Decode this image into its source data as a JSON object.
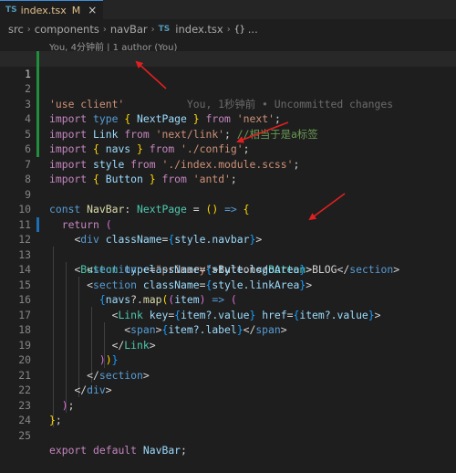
{
  "tab": {
    "lang": "TS",
    "filename": "index.tsx",
    "modified": "M",
    "close": "×"
  },
  "breadcrumb": {
    "items": [
      "src",
      "components",
      "navBar",
      "index.tsx",
      "..."
    ],
    "ts_badge": "TS",
    "braces": "{}"
  },
  "blame_header": "You, 4分钟前 | 1 author (You)",
  "inline_blame": "You, 1秒钟前 • Uncommitted changes",
  "line_numbers": [
    "1",
    "2",
    "3",
    "4",
    "5",
    "6",
    "7",
    "8",
    "9",
    "10",
    "11",
    "12",
    "13",
    "14",
    "15",
    "16",
    "17",
    "18",
    "19",
    "20",
    "21",
    "22",
    "23",
    "24",
    "25"
  ],
  "code": {
    "l1": "'use client'",
    "l2": {
      "import": "import",
      "type": "type",
      "name": "NextPage",
      "from": "from",
      "src": "'next'"
    },
    "l3": {
      "import": "import",
      "name": "Link",
      "from": "from",
      "src": "'next/link'",
      "comment": "//相当于是a标签"
    },
    "l4": {
      "import": "import",
      "name": "navs",
      "from": "from",
      "src": "'./config'"
    },
    "l5": {
      "import": "import",
      "name": "style",
      "from": "from",
      "src": "'./index.module.scss'"
    },
    "l6": {
      "import": "import",
      "name": "Button",
      "from": "from",
      "src": "'antd'"
    },
    "l9": {
      "const": "const",
      "name": "NavBar",
      "type": "NextPage"
    },
    "l10": "return",
    "l11": {
      "tag": "div",
      "attr": "className",
      "val": "style.navbar"
    },
    "l12": {
      "tag": "Button",
      "attr": "type",
      "val": "\"primary\"",
      "text": "Button"
    },
    "l13": {
      "tag": "section",
      "attr": "className",
      "val": "style.logoArea",
      "text": "BLOG"
    },
    "l14": {
      "tag": "section",
      "attr": "className",
      "val": "style.linkArea"
    },
    "l15": {
      "obj": "navs",
      "method": "map",
      "param": "item"
    },
    "l16": {
      "tag": "Link",
      "attr1": "key",
      "val1": "item?.value",
      "attr2": "href",
      "val2": "item?.value"
    },
    "l17": {
      "tag": "span",
      "val": "item?.label"
    },
    "l18": {
      "tag": "Link"
    },
    "l20": {
      "tag": "section"
    },
    "l21": {
      "tag": "div"
    },
    "l25": {
      "export": "export",
      "default": "default",
      "name": "NavBar"
    }
  },
  "colors": {
    "background": "#1e1e1e",
    "keyword": "#c586c0",
    "string": "#ce9178",
    "variable": "#9cdcfe",
    "annotation_arrow": "#e02020",
    "git_added": "#1f8f3b",
    "git_modified": "#1b6fb5"
  }
}
